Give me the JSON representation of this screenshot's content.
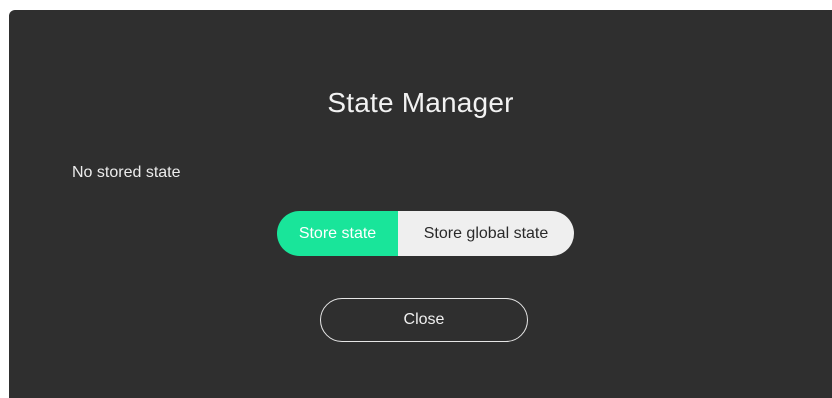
{
  "dialog": {
    "title": "State Manager",
    "status_text": "No stored state",
    "actions": {
      "store_state_label": "Store state",
      "store_global_state_label": "Store global state"
    },
    "close_label": "Close"
  },
  "colors": {
    "dialog_background": "#2f2f2f",
    "primary_accent": "#19e59a",
    "secondary_button": "#efefef",
    "text_light": "#f2f2f2"
  }
}
